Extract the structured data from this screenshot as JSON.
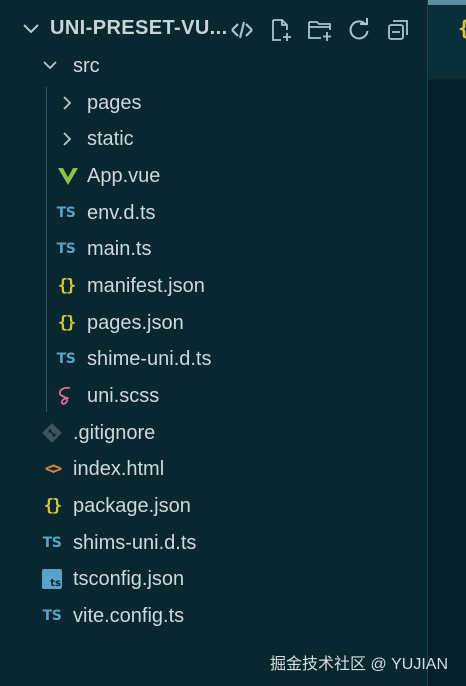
{
  "header": {
    "title": "UNI-PRESET-VU...",
    "actions": [
      {
        "name": "git-compare-icon"
      },
      {
        "name": "new-file-icon"
      },
      {
        "name": "new-folder-icon"
      },
      {
        "name": "refresh-icon"
      },
      {
        "name": "collapse-all-icon"
      }
    ]
  },
  "tree": {
    "src": {
      "label": "src",
      "icon": "chevron-down-icon"
    },
    "pages": {
      "label": "pages",
      "icon": "chevron-right-icon"
    },
    "static": {
      "label": "static",
      "icon": "chevron-right-icon"
    },
    "app_vue": {
      "label": "App.vue",
      "icon": "vue-icon"
    },
    "env_d_ts": {
      "label": "env.d.ts",
      "icon_text": "TS"
    },
    "main_ts": {
      "label": "main.ts",
      "icon_text": "TS"
    },
    "manifest_json": {
      "label": "manifest.json",
      "icon_text": "{}"
    },
    "pages_json": {
      "label": "pages.json",
      "icon_text": "{}"
    },
    "shime_uni_d_ts": {
      "label": "shime-uni.d.ts",
      "icon_text": "TS"
    },
    "uni_scss": {
      "label": "uni.scss",
      "icon": "sass-icon"
    },
    "gitignore": {
      "label": ".gitignore",
      "icon": "git-icon"
    },
    "index_html": {
      "label": "index.html",
      "icon_text": "<>"
    },
    "package_json": {
      "label": "package.json",
      "icon_text": "{}"
    },
    "shims_uni_d_ts": {
      "label": "shims-uni.d.ts",
      "icon_text": "TS"
    },
    "tsconfig_json": {
      "label": "tsconfig.json",
      "icon_text": "ts"
    },
    "vite_config_ts": {
      "label": "vite.config.ts",
      "icon_text": "TS"
    }
  },
  "editor_tab": {
    "glyph": "{"
  },
  "watermark": "掘金技术社区 @ YUJIAN",
  "colors": {
    "background": "#08272f",
    "text": "#cdd9dd",
    "ts": "#5aa3c8",
    "json": "#d3c43d",
    "html": "#d78646",
    "vue": "#8dc149",
    "sass": "#e66ea3",
    "git": "#41535b"
  }
}
